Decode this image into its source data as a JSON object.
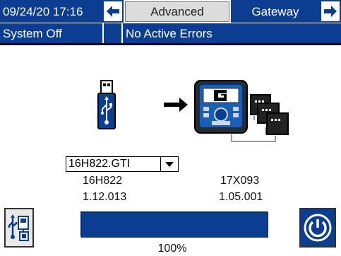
{
  "header": {
    "datetime": "09/24/20 17:16",
    "tab_advanced": "Advanced",
    "tab_gateway": "Gateway",
    "status": "System Off",
    "errors": "No Active Errors"
  },
  "upgrade": {
    "selected_file": "16H822.GTI",
    "left_part": "16H822",
    "left_version": "1.12.013",
    "right_part": "17X093",
    "right_version": "1.05.001",
    "progress_fraction": 1.0,
    "progress_label": "100%"
  },
  "icons": {
    "usb": "usb-drive-icon",
    "transfer_arrow": "right-arrow-icon",
    "gateway": "gateway-module-icon",
    "nodes": "network-nodes-icon",
    "install": "usb-install-icon",
    "power": "power-icon"
  },
  "colors": {
    "brand_blue": "#0b3d91",
    "tab_gray": "#dcdcdc"
  }
}
